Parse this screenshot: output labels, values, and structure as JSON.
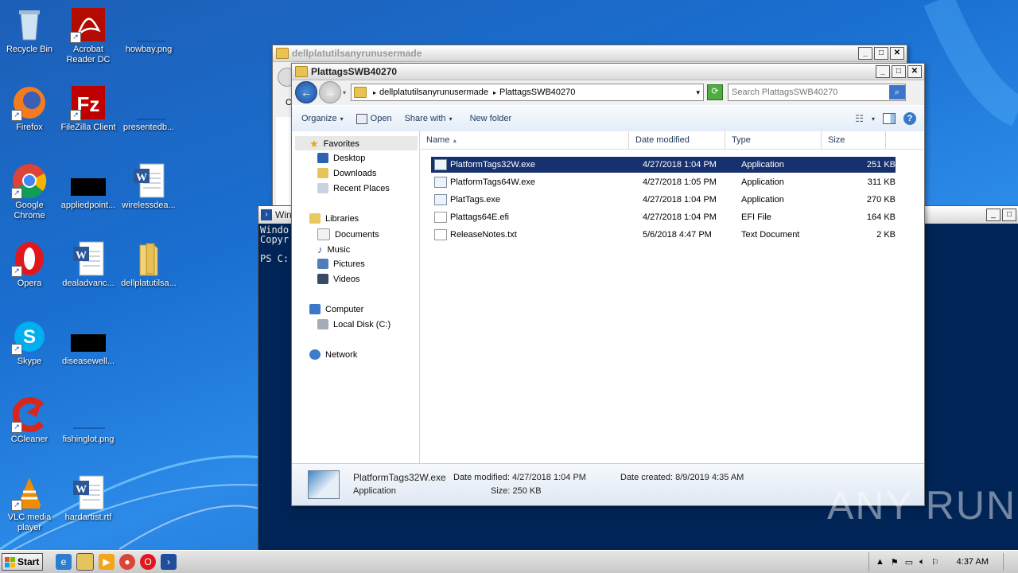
{
  "desktop": {
    "icons": [
      {
        "label": "Recycle Bin",
        "icon": "recycle-bin-icon"
      },
      {
        "label": "Acrobat Reader DC",
        "icon": "acrobat-icon"
      },
      {
        "label": "howbay.png",
        "icon": "image-file-icon"
      },
      {
        "label": "Firefox",
        "icon": "firefox-icon"
      },
      {
        "label": "FileZilla Client",
        "icon": "filezilla-icon"
      },
      {
        "label": "presentedb...",
        "icon": "file-icon"
      },
      {
        "label": "Google Chrome",
        "icon": "chrome-icon"
      },
      {
        "label": "appliedpoint...",
        "icon": "file-icon"
      },
      {
        "label": "wirelessdea...",
        "icon": "word-icon"
      },
      {
        "label": "Opera",
        "icon": "opera-icon"
      },
      {
        "label": "dealadvanc...",
        "icon": "word-icon"
      },
      {
        "label": "dellplatutilsa...",
        "icon": "folder-icon"
      },
      {
        "label": "Skype",
        "icon": "skype-icon"
      },
      {
        "label": "diseasewell...",
        "icon": "file-icon"
      },
      {
        "label": "CCleaner",
        "icon": "ccleaner-icon"
      },
      {
        "label": "fishinglot.png",
        "icon": "image-file-icon"
      },
      {
        "label": "VLC media player",
        "icon": "vlc-icon"
      },
      {
        "label": "hardartist.rtf",
        "icon": "word-icon"
      }
    ]
  },
  "back_window": {
    "title": "dellplatutilsanyrunusermade",
    "partial_label": "C"
  },
  "powershell": {
    "title": "Win",
    "lines": "Windo\nCopyr\n\nPS C:"
  },
  "explorer": {
    "title": "PlattagsSWB40270",
    "breadcrumb": [
      "dellplatutilsanyrunusermade",
      "PlattagsSWB40270"
    ],
    "search_placeholder": "Search PlattagsSWB40270",
    "toolbar": {
      "organize": "Organize",
      "open": "Open",
      "share_with": "Share with",
      "new_folder": "New folder"
    },
    "nav": {
      "favorites": "Favorites",
      "desktop": "Desktop",
      "downloads": "Downloads",
      "recent_places": "Recent Places",
      "libraries": "Libraries",
      "documents": "Documents",
      "music": "Music",
      "pictures": "Pictures",
      "videos": "Videos",
      "computer": "Computer",
      "local_disk": "Local Disk (C:)",
      "network": "Network"
    },
    "columns": {
      "name": "Name",
      "date": "Date modified",
      "type": "Type",
      "size": "Size"
    },
    "files": [
      {
        "name": "PlatformTags32W.exe",
        "date": "4/27/2018 1:04 PM",
        "type": "Application",
        "size": "251 KB"
      },
      {
        "name": "PlatformTags64W.exe",
        "date": "4/27/2018 1:05 PM",
        "type": "Application",
        "size": "311 KB"
      },
      {
        "name": "PlatTags.exe",
        "date": "4/27/2018 1:04 PM",
        "type": "Application",
        "size": "270 KB"
      },
      {
        "name": "Plattags64E.efi",
        "date": "4/27/2018 1:04 PM",
        "type": "EFI File",
        "size": "164 KB"
      },
      {
        "name": "ReleaseNotes.txt",
        "date": "5/6/2018 4:47 PM",
        "type": "Text Document",
        "size": "2 KB"
      }
    ],
    "details": {
      "name": "PlatformTags32W.exe",
      "type": "Application",
      "date_modified": "Date modified: 4/27/2018 1:04 PM",
      "size": "Size: 250 KB",
      "date_created": "Date created: 8/9/2019 4:35 AM"
    }
  },
  "taskbar": {
    "start": "Start",
    "time": "4:37 AM"
  },
  "watermark": "ANY RUN"
}
